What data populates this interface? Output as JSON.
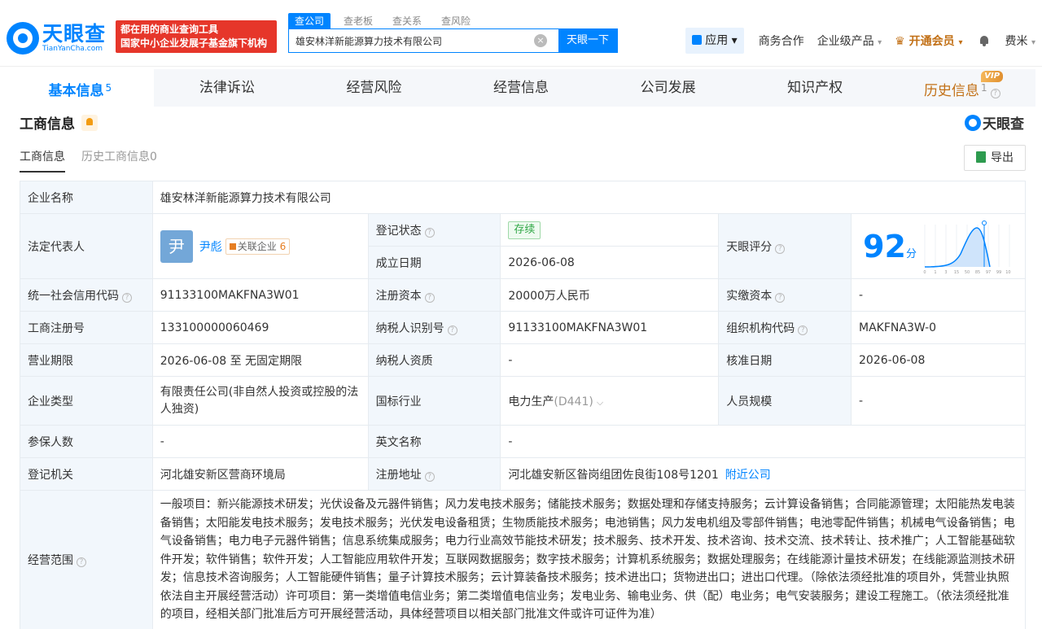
{
  "header": {
    "logo_cn": "天眼查",
    "logo_en": "TianYanCha.com",
    "slogan_line1": "都在用的商业查询工具",
    "slogan_line2": "国家中小企业发展子基金旗下机构",
    "search_tabs": [
      "查公司",
      "查老板",
      "查关系",
      "查风险"
    ],
    "search_value": "雄安林洋新能源算力技术有限公司",
    "search_button": "天眼一下",
    "app_label": "应用",
    "nav": [
      "商务合作",
      "企业级产品"
    ],
    "vip_label": "开通会员",
    "user": "费米"
  },
  "tabs": [
    {
      "label": "基本信息",
      "count": "5"
    },
    {
      "label": "法律诉讼",
      "count": ""
    },
    {
      "label": "经营风险",
      "count": ""
    },
    {
      "label": "经营信息",
      "count": ""
    },
    {
      "label": "公司发展",
      "count": ""
    },
    {
      "label": "知识产权",
      "count": ""
    },
    {
      "label": "历史信息",
      "count": "1",
      "badge": "VIP"
    }
  ],
  "section": {
    "title": "工商信息",
    "brand": "天眼查",
    "subtabs": [
      "工商信息",
      "历史工商信息0"
    ],
    "export": "导出"
  },
  "info": {
    "company_name_label": "企业名称",
    "company_name": "雄安林洋新能源算力技术有限公司",
    "legal_rep_label": "法定代表人",
    "legal_rep_avatar": "尹",
    "legal_rep": "尹彪",
    "related_label": "关联企业",
    "related_count": "6",
    "reg_status_label": "登记状态",
    "reg_status": "存续",
    "est_date_label": "成立日期",
    "est_date": "2026-06-08",
    "score_label": "天眼评分",
    "score": "92",
    "score_unit": "分",
    "credit_code_label": "统一社会信用代码",
    "credit_code": "91133100MAKFNA3W01",
    "reg_capital_label": "注册资本",
    "reg_capital": "20000万人民币",
    "paid_capital_label": "实缴资本",
    "paid_capital": "-",
    "reg_no_label": "工商注册号",
    "reg_no": "133100000060469",
    "taxpayer_id_label": "纳税人识别号",
    "taxpayer_id": "91133100MAKFNA3W01",
    "org_code_label": "组织机构代码",
    "org_code": "MAKFNA3W-0",
    "term_label": "营业期限",
    "term": "2026-06-08 至 无固定期限",
    "taxpayer_qual_label": "纳税人资质",
    "taxpayer_qual": "-",
    "approve_date_label": "核准日期",
    "approve_date": "2026-06-08",
    "type_label": "企业类型",
    "type": "有限责任公司(非自然人投资或控股的法人独资)",
    "industry_label": "国标行业",
    "industry": "电力生产",
    "industry_code": "(D441)",
    "staff_label": "人员规模",
    "staff": "-",
    "insured_label": "参保人数",
    "insured": "-",
    "en_name_label": "英文名称",
    "en_name": "-",
    "authority_label": "登记机关",
    "authority": "河北雄安新区营商环境局",
    "address_label": "注册地址",
    "address": "河北雄安新区昝岗组团佐良街108号1201",
    "nearby": "附近公司",
    "scope_label": "经营范围",
    "scope": "一般项目：新兴能源技术研发；光伏设备及元器件销售；风力发电技术服务；储能技术服务；数据处理和存储支持服务；云计算设备销售；合同能源管理；太阳能热发电装备销售；太阳能发电技术服务；发电技术服务；光伏发电设备租赁；生物质能技术服务；电池销售；风力发电机组及零部件销售；电池零配件销售；机械电气设备销售；电气设备销售；电力电子元器件销售；信息系统集成服务；电力行业高效节能技术研发；技术服务、技术开发、技术咨询、技术交流、技术转让、技术推广；人工智能基础软件开发；软件销售；软件开发；人工智能应用软件开发；互联网数据服务；数字技术服务；计算机系统服务；数据处理服务；在线能源计量技术研发；在线能源监测技术研发；信息技术咨询服务；人工智能硬件销售；量子计算技术服务；云计算装备技术服务；技术进出口；货物进出口；进出口代理。（除依法须经批准的项目外，凭营业执照依法自主开展经营活动）许可项目：第一类增值电信业务；第二类增值电信业务；发电业务、输电业务、供（配）电业务；电气安装服务；建设工程施工。（依法须经批准的项目，经相关部门批准后方可开展经营活动，具体经营项目以相关部门批准文件或许可证件为准）"
  },
  "score_chart": {
    "x_ticks": [
      "0",
      "1",
      "3",
      "15",
      "50",
      "85",
      "97",
      "99",
      "100"
    ]
  },
  "colors": {
    "accent": "#0084ff",
    "vip": "#c27016",
    "slogan_bg": "#e6362a"
  }
}
